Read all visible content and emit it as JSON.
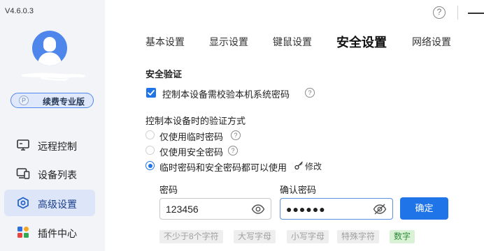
{
  "app": {
    "version": "V4.6.0.3"
  },
  "account": {
    "badge_label": "续费专业版",
    "badge_icon_letter": "P"
  },
  "sidebar": {
    "items": [
      {
        "label": "远程控制",
        "icon": "monitor-icon"
      },
      {
        "label": "设备列表",
        "icon": "devices-icon"
      },
      {
        "label": "高级设置",
        "icon": "settings-icon",
        "active": true
      },
      {
        "label": "插件中心",
        "icon": "plugins-icon"
      }
    ]
  },
  "topbar": {
    "help_glyph": "?"
  },
  "tabs": [
    {
      "label": "基本设置"
    },
    {
      "label": "显示设置"
    },
    {
      "label": "键鼠设置"
    },
    {
      "label": "安全设置",
      "active": true
    },
    {
      "label": "网络设置"
    }
  ],
  "security": {
    "section_title": "安全验证",
    "require_system_password": {
      "label": "控制本设备需校验本机系统密码",
      "checked": true
    },
    "method_title": "控制本设备时的验证方式",
    "methods": [
      {
        "label": "仅使用临时密码",
        "selected": false
      },
      {
        "label": "仅使用安全密码",
        "selected": false
      },
      {
        "label": "临时密码和安全密码都可以使用",
        "selected": true
      }
    ],
    "edit_label": "修改",
    "password_label": "密码",
    "password_value": "123456",
    "confirm_label": "确认密码",
    "confirm_value": "●●●●●●",
    "confirm_button": "确定",
    "requirements": [
      {
        "label": "不少于8个字符",
        "met": false
      },
      {
        "label": "大写字母",
        "met": false
      },
      {
        "label": "小写字母",
        "met": false
      },
      {
        "label": "特殊字符",
        "met": false
      },
      {
        "label": "数字",
        "met": true
      }
    ]
  },
  "colors": {
    "accent": "#1f74e8",
    "sidebar_bg": "#f3f4f7",
    "active_nav_bg": "#dce6f8",
    "ok_chip_bg": "#d9f2d6"
  }
}
